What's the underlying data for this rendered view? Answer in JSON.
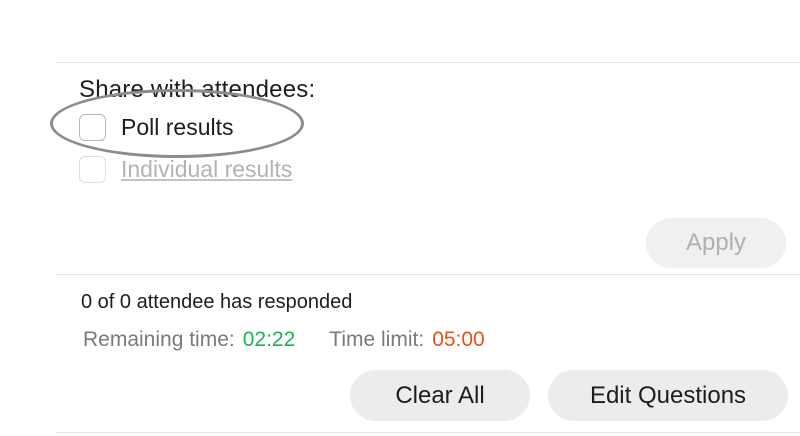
{
  "share": {
    "title": "Share with attendees:",
    "options": [
      {
        "label": "Poll results",
        "checked": false,
        "enabled": true
      },
      {
        "label": "Individual results",
        "checked": false,
        "enabled": false
      }
    ],
    "apply_label": "Apply"
  },
  "status": {
    "responded_text": "0 of 0 attendee has responded",
    "remaining_label": "Remaining time:",
    "remaining_value": "02:22",
    "limit_label": "Time limit:",
    "limit_value": "05:00"
  },
  "actions": {
    "clear_label": "Clear All",
    "edit_label": "Edit Questions"
  },
  "colors": {
    "remaining_value": "#1fb054",
    "limit_value": "#e0531a",
    "highlight_ring": "#8c8c8c"
  }
}
